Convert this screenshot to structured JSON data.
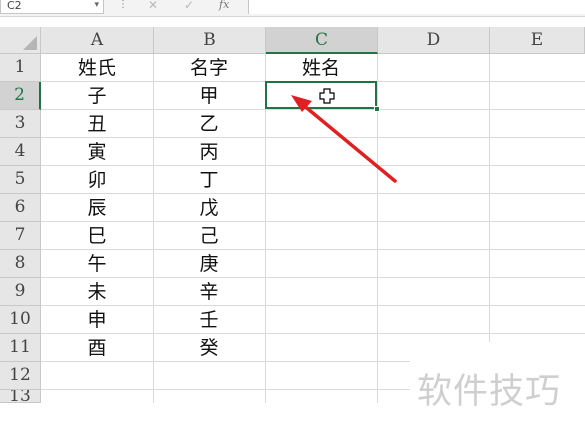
{
  "formula_bar": {
    "name_box": "C2",
    "dropdown_glyph": "▾",
    "separator_glyph": "⋮",
    "cancel_glyph": "✕",
    "confirm_glyph": "✓",
    "fx_label": "fx",
    "formula_value": ""
  },
  "columns": [
    "A",
    "B",
    "C",
    "D",
    "E"
  ],
  "selected_column": "C",
  "rows": [
    "1",
    "2",
    "3",
    "4",
    "5",
    "6",
    "7",
    "8",
    "9",
    "10",
    "11",
    "12",
    "13"
  ],
  "selected_row": "2",
  "cells": {
    "A1": "姓氏",
    "B1": "名字",
    "C1": "姓名",
    "A2": "子",
    "B2": "甲",
    "A3": "丑",
    "B3": "乙",
    "A4": "寅",
    "B4": "丙",
    "A5": "卯",
    "B5": "丁",
    "A6": "辰",
    "B6": "戊",
    "A7": "巳",
    "B7": "己",
    "A8": "午",
    "B8": "庚",
    "A9": "未",
    "B9": "辛",
    "A10": "申",
    "B10": "壬",
    "A11": "酉",
    "B11": "癸"
  },
  "active_cell": "C2",
  "watermark": "软件技巧",
  "colors": {
    "accent": "#217346",
    "arrow": "#e02020",
    "header_bg": "#e6e6e6",
    "gridline": "#dadada"
  },
  "icons": {
    "cursor": "plus-cursor-icon",
    "annotation": "red-arrow-annotation"
  }
}
